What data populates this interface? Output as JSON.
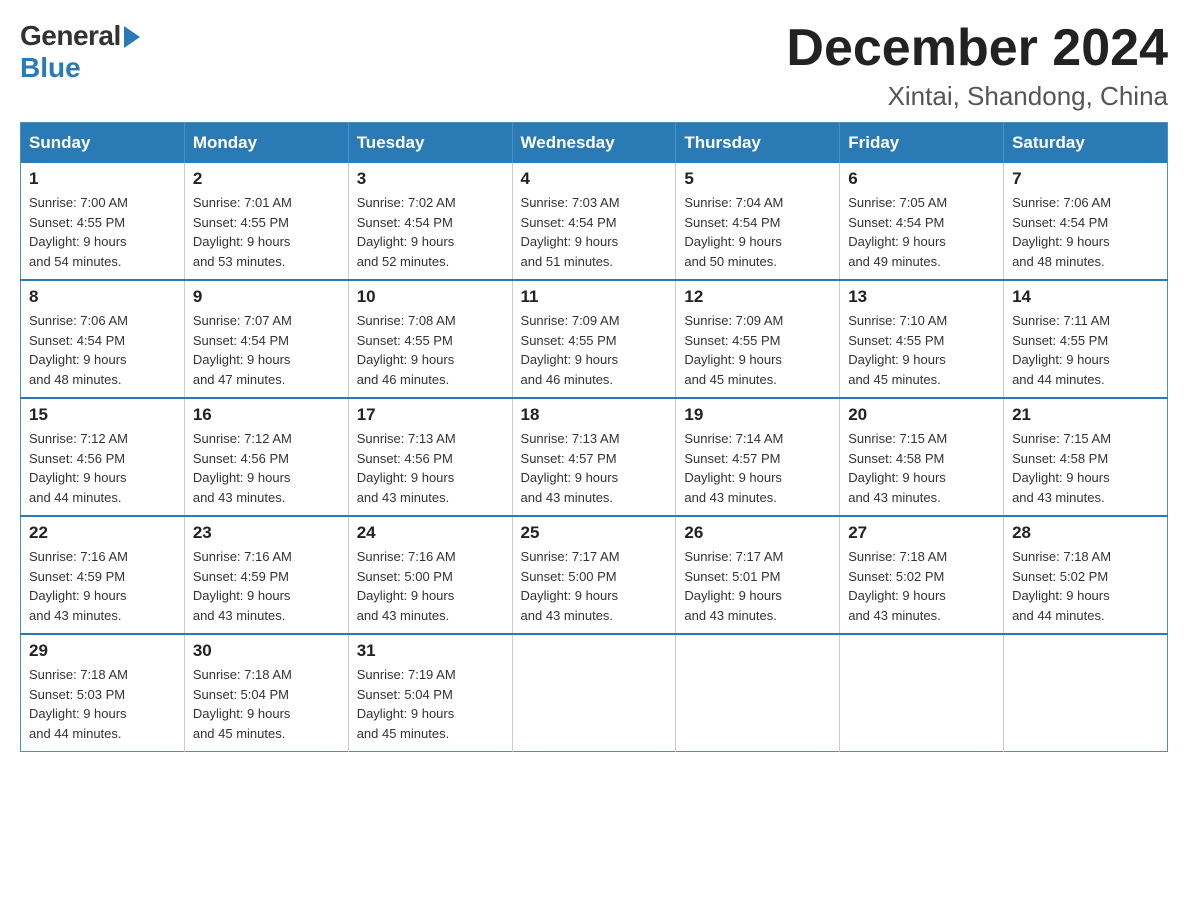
{
  "header": {
    "title": "December 2024",
    "subtitle": "Xintai, Shandong, China",
    "logo_general": "General",
    "logo_blue": "Blue"
  },
  "calendar": {
    "days_of_week": [
      "Sunday",
      "Monday",
      "Tuesday",
      "Wednesday",
      "Thursday",
      "Friday",
      "Saturday"
    ],
    "weeks": [
      [
        {
          "day": "1",
          "sunrise": "7:00 AM",
          "sunset": "4:55 PM",
          "daylight": "9 hours and 54 minutes."
        },
        {
          "day": "2",
          "sunrise": "7:01 AM",
          "sunset": "4:55 PM",
          "daylight": "9 hours and 53 minutes."
        },
        {
          "day": "3",
          "sunrise": "7:02 AM",
          "sunset": "4:54 PM",
          "daylight": "9 hours and 52 minutes."
        },
        {
          "day": "4",
          "sunrise": "7:03 AM",
          "sunset": "4:54 PM",
          "daylight": "9 hours and 51 minutes."
        },
        {
          "day": "5",
          "sunrise": "7:04 AM",
          "sunset": "4:54 PM",
          "daylight": "9 hours and 50 minutes."
        },
        {
          "day": "6",
          "sunrise": "7:05 AM",
          "sunset": "4:54 PM",
          "daylight": "9 hours and 49 minutes."
        },
        {
          "day": "7",
          "sunrise": "7:06 AM",
          "sunset": "4:54 PM",
          "daylight": "9 hours and 48 minutes."
        }
      ],
      [
        {
          "day": "8",
          "sunrise": "7:06 AM",
          "sunset": "4:54 PM",
          "daylight": "9 hours and 48 minutes."
        },
        {
          "day": "9",
          "sunrise": "7:07 AM",
          "sunset": "4:54 PM",
          "daylight": "9 hours and 47 minutes."
        },
        {
          "day": "10",
          "sunrise": "7:08 AM",
          "sunset": "4:55 PM",
          "daylight": "9 hours and 46 minutes."
        },
        {
          "day": "11",
          "sunrise": "7:09 AM",
          "sunset": "4:55 PM",
          "daylight": "9 hours and 46 minutes."
        },
        {
          "day": "12",
          "sunrise": "7:09 AM",
          "sunset": "4:55 PM",
          "daylight": "9 hours and 45 minutes."
        },
        {
          "day": "13",
          "sunrise": "7:10 AM",
          "sunset": "4:55 PM",
          "daylight": "9 hours and 45 minutes."
        },
        {
          "day": "14",
          "sunrise": "7:11 AM",
          "sunset": "4:55 PM",
          "daylight": "9 hours and 44 minutes."
        }
      ],
      [
        {
          "day": "15",
          "sunrise": "7:12 AM",
          "sunset": "4:56 PM",
          "daylight": "9 hours and 44 minutes."
        },
        {
          "day": "16",
          "sunrise": "7:12 AM",
          "sunset": "4:56 PM",
          "daylight": "9 hours and 43 minutes."
        },
        {
          "day": "17",
          "sunrise": "7:13 AM",
          "sunset": "4:56 PM",
          "daylight": "9 hours and 43 minutes."
        },
        {
          "day": "18",
          "sunrise": "7:13 AM",
          "sunset": "4:57 PM",
          "daylight": "9 hours and 43 minutes."
        },
        {
          "day": "19",
          "sunrise": "7:14 AM",
          "sunset": "4:57 PM",
          "daylight": "9 hours and 43 minutes."
        },
        {
          "day": "20",
          "sunrise": "7:15 AM",
          "sunset": "4:58 PM",
          "daylight": "9 hours and 43 minutes."
        },
        {
          "day": "21",
          "sunrise": "7:15 AM",
          "sunset": "4:58 PM",
          "daylight": "9 hours and 43 minutes."
        }
      ],
      [
        {
          "day": "22",
          "sunrise": "7:16 AM",
          "sunset": "4:59 PM",
          "daylight": "9 hours and 43 minutes."
        },
        {
          "day": "23",
          "sunrise": "7:16 AM",
          "sunset": "4:59 PM",
          "daylight": "9 hours and 43 minutes."
        },
        {
          "day": "24",
          "sunrise": "7:16 AM",
          "sunset": "5:00 PM",
          "daylight": "9 hours and 43 minutes."
        },
        {
          "day": "25",
          "sunrise": "7:17 AM",
          "sunset": "5:00 PM",
          "daylight": "9 hours and 43 minutes."
        },
        {
          "day": "26",
          "sunrise": "7:17 AM",
          "sunset": "5:01 PM",
          "daylight": "9 hours and 43 minutes."
        },
        {
          "day": "27",
          "sunrise": "7:18 AM",
          "sunset": "5:02 PM",
          "daylight": "9 hours and 43 minutes."
        },
        {
          "day": "28",
          "sunrise": "7:18 AM",
          "sunset": "5:02 PM",
          "daylight": "9 hours and 44 minutes."
        }
      ],
      [
        {
          "day": "29",
          "sunrise": "7:18 AM",
          "sunset": "5:03 PM",
          "daylight": "9 hours and 44 minutes."
        },
        {
          "day": "30",
          "sunrise": "7:18 AM",
          "sunset": "5:04 PM",
          "daylight": "9 hours and 45 minutes."
        },
        {
          "day": "31",
          "sunrise": "7:19 AM",
          "sunset": "5:04 PM",
          "daylight": "9 hours and 45 minutes."
        },
        null,
        null,
        null,
        null
      ]
    ],
    "labels": {
      "sunrise": "Sunrise:",
      "sunset": "Sunset:",
      "daylight": "Daylight:"
    }
  }
}
